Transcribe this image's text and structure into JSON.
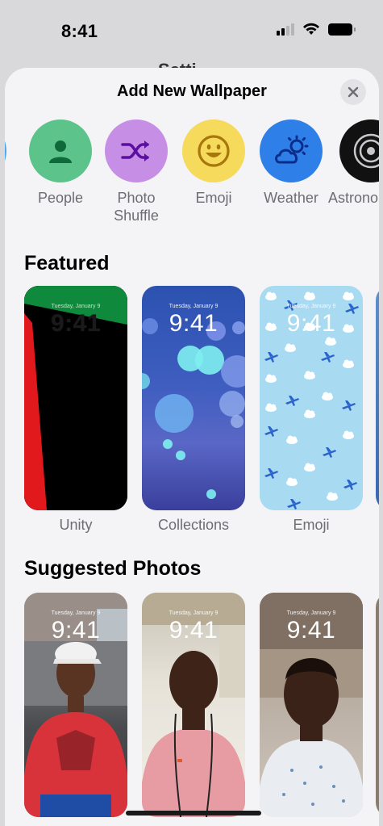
{
  "status_bar": {
    "time": "8:41"
  },
  "background_title": "Setti",
  "sheet": {
    "title": "Add New Wallpaper",
    "close_icon": "close-icon"
  },
  "categories": [
    {
      "label": "People",
      "icon": "person-icon",
      "color": "#5cc38a"
    },
    {
      "label": "Photo\nShuffle",
      "icon": "shuffle-icon",
      "color": "#c78ee6"
    },
    {
      "label": "Emoji",
      "icon": "smiley-icon",
      "color": "#f5da5b"
    },
    {
      "label": "Weather",
      "icon": "cloud-sun-icon",
      "color": "#2f7fe8"
    },
    {
      "label": "Astrono",
      "icon": "orbit-icon",
      "color": "#111111"
    }
  ],
  "featured": {
    "title": "Featured",
    "items": [
      {
        "label": "Unity",
        "date": "Tuesday, January 9",
        "time": "9:41"
      },
      {
        "label": "Collections",
        "date": "Tuesday, January 9",
        "time": "9:41"
      },
      {
        "label": "Emoji",
        "date": "Tuesday, January 9",
        "time": "9:41"
      }
    ]
  },
  "suggested": {
    "title": "Suggested Photos",
    "items": [
      {
        "date": "Tuesday, January 9",
        "time": "9:41"
      },
      {
        "date": "Tuesday, January 9",
        "time": "9:41"
      },
      {
        "date": "Tuesday, January 9",
        "time": "9:41"
      }
    ]
  }
}
